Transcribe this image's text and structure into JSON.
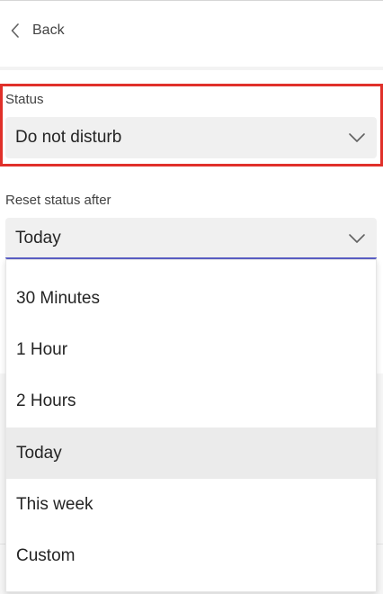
{
  "header": {
    "back_label": "Back",
    "back_icon": "chevron-left-icon"
  },
  "status": {
    "label": "Status",
    "value": "Do not disturb",
    "icon": "chevron-down-icon",
    "highlight_color": "#e0302a"
  },
  "reset": {
    "label": "Reset status after",
    "value": "Today",
    "icon": "chevron-down-icon",
    "accent_color": "#5b5fc7"
  },
  "dropdown": {
    "options": [
      {
        "label": "30 Minutes"
      },
      {
        "label": "1 Hour"
      },
      {
        "label": "2 Hours"
      },
      {
        "label": "Today",
        "selected": true
      },
      {
        "label": "This week"
      },
      {
        "label": "Custom"
      }
    ]
  }
}
